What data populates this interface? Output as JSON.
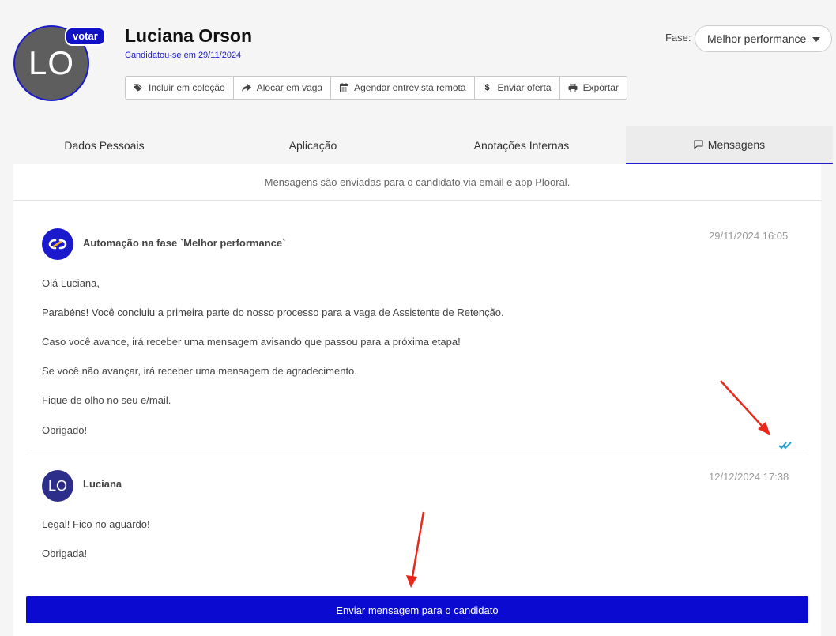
{
  "candidate": {
    "initials": "LO",
    "vote_label": "votar",
    "name": "Luciana Orson",
    "applied_text": "Candidatou-se em 29/11/2024"
  },
  "actions": [
    {
      "label": "Incluir em coleção",
      "icon": "tags-icon"
    },
    {
      "label": "Alocar em vaga",
      "icon": "share-arrow-icon"
    },
    {
      "label": "Agendar entrevista remota",
      "icon": "calendar-icon"
    },
    {
      "label": "Enviar oferta",
      "icon": "dollar-icon"
    },
    {
      "label": "Exportar",
      "icon": "print-icon"
    }
  ],
  "stage": {
    "label": "Fase:",
    "value": "Melhor performance"
  },
  "tabs": [
    {
      "label": "Dados Pessoais"
    },
    {
      "label": "Aplicação"
    },
    {
      "label": "Anotações Internas"
    },
    {
      "label": "Mensagens",
      "active": true,
      "icon": "comment-icon"
    }
  ],
  "messages_panel": {
    "notice": "Mensagens são enviadas para o candidato via email e app Plooral.",
    "messages": [
      {
        "sender": "Automação na fase `Melhor performance`",
        "timestamp": "29/11/2024 16:05",
        "lines": [
          "Olá Luciana,",
          "Parabéns! Você concluiu a primeira parte do nosso processo para a vaga de Assistente de Retenção.",
          "Caso você avance, irá receber uma mensagem avisando que passou para a próxima etapa!",
          "Se você não avançar, irá receber uma mensagem de agradecimento.",
          "Fique de olho no seu e/mail.",
          "Obrigado!"
        ],
        "read_icon": "double-check-icon"
      },
      {
        "sender": "Luciana",
        "sender_initials": "LO",
        "timestamp": "12/12/2024 17:38",
        "lines": [
          "Legal! Fico no aguardo!",
          "Obrigada!"
        ]
      }
    ],
    "send_button": "Enviar mensagem para o candidato"
  },
  "colors": {
    "brand": "#1a1acc",
    "button": "#0a0ad0",
    "read_tick": "#2a9fd6",
    "annotation_arrow": "#e8291c"
  }
}
